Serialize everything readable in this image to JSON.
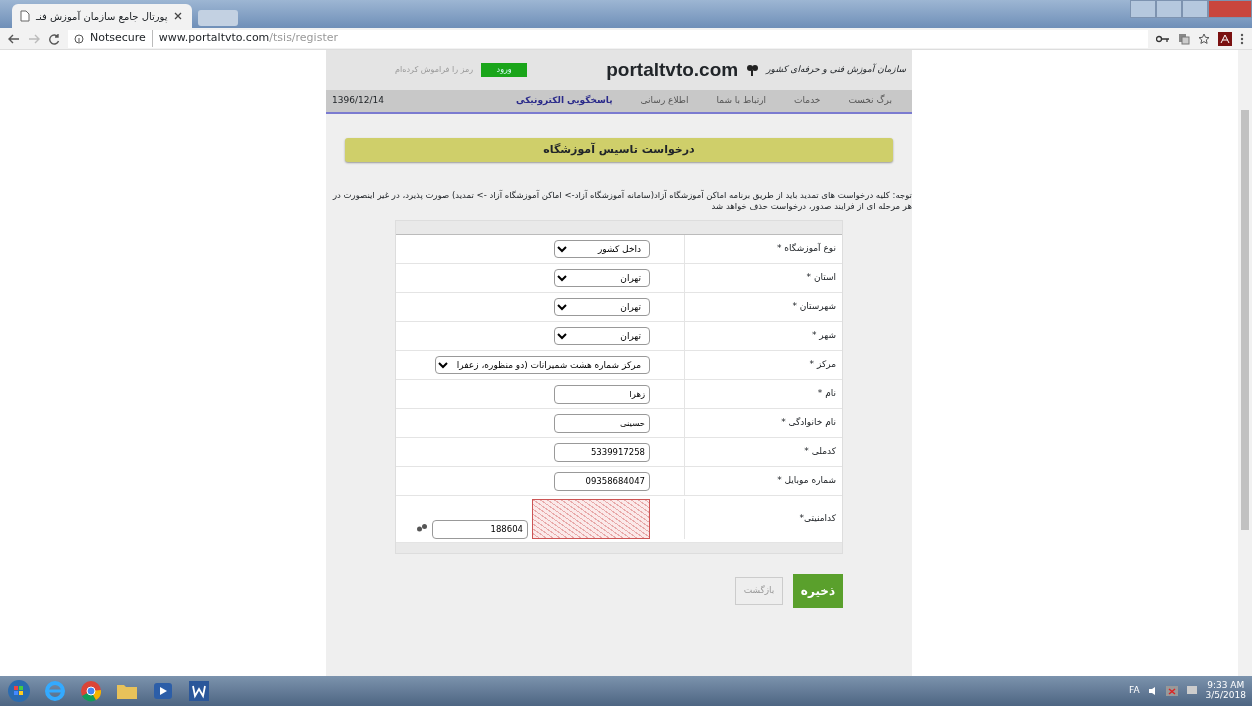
{
  "browser": {
    "tab_title": "پورتال جامع سازمان آموزش فنـ",
    "security_label": "Notsecure",
    "url_host": "www.portaltvto.com",
    "url_path": "/tsis/register"
  },
  "header": {
    "org_name": "سازمان آموزش فنی و حرفه‌ای کشور",
    "logo_text": "portaltvto.com",
    "login_button": "ورود",
    "forgot_link": "رمز را فراموش کرده‌ام",
    "date": "1396/12/14",
    "nav": [
      {
        "label": "برگ نخست",
        "selected": false
      },
      {
        "label": "خدمات",
        "selected": false
      },
      {
        "label": "ارتباط با شما",
        "selected": false
      },
      {
        "label": "اطلاع رسانی",
        "selected": false
      },
      {
        "label": "پاسخگویی الکترونیکی",
        "selected": true
      }
    ]
  },
  "form": {
    "title": "درخواست تاسیس آموزشگاه",
    "notice": "توجه: کلیه درخواست های تمدید باید از طریق برنامه اماکن آموزشگاه آزاد(سامانه آموزشگاه آزاد-> اماکن آموزشگاه آزاد -> تمدید) صورت پذیرد، در غیر اینصورت در هر مرحله ای از فرایند صدور، درخواست حذف خواهد شد",
    "fields": [
      {
        "label": "نوع آموزشگاه *",
        "kind": "select",
        "value": "داخل کشور"
      },
      {
        "label": "استان *",
        "kind": "select",
        "value": "تهران"
      },
      {
        "label": "شهرستان *",
        "kind": "select",
        "value": "تهران"
      },
      {
        "label": "شهر *",
        "kind": "select",
        "value": "تهران"
      },
      {
        "label": "مرکز *",
        "kind": "select",
        "value": "مرکز شماره هشت شمیرانات (دو منظوره، زعفرا"
      },
      {
        "label": "نام *",
        "kind": "text",
        "value": "زهرا"
      },
      {
        "label": "نام خانوادگی *",
        "kind": "text",
        "value": "حسینی"
      },
      {
        "label": "کدملی *",
        "kind": "text",
        "value": "5339917258"
      },
      {
        "label": "شماره موبایل *",
        "kind": "text",
        "value": "09358684047"
      },
      {
        "label": "کدامنیتی*",
        "kind": "captcha",
        "value": "188604"
      }
    ],
    "buttons": [
      {
        "label": "ذخیره",
        "kind": "primary"
      },
      {
        "label": "بازگشت",
        "kind": "secondary"
      }
    ]
  },
  "taskbar": {
    "language": "FA",
    "time": "9:33 AM",
    "date": "3/5/2018"
  }
}
